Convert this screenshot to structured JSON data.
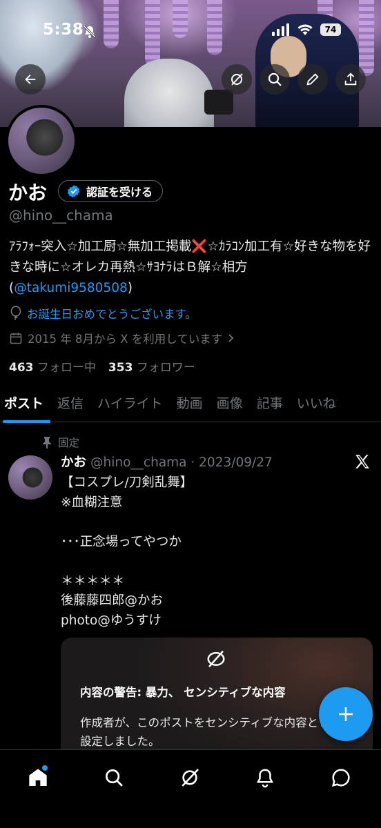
{
  "status_bar": {
    "time": "5:38",
    "battery": "74"
  },
  "profile": {
    "name": "かお",
    "verify_label": "認証を受ける",
    "handle": "@hino__chama",
    "bio_text": "ｱﾗﾌｫｰ突入☆加工厨☆無加工掲載❌☆ｶﾗｺﾝ加工有☆好きな物を好きな時に☆オレカ再熱☆ｻﾖﾅﾗはＢ解☆相方",
    "bio_mention_open": "(",
    "bio_mention": "@takumi9580508",
    "bio_mention_close": ")",
    "birthday": "お誕生日おめでとうございます。",
    "joined": "2015 年 8月から X を利用しています",
    "following_count": "463",
    "following_label": "フォロー中",
    "followers_count": "353",
    "followers_label": "フォロワー"
  },
  "tabs": [
    "ポスト",
    "返信",
    "ハイライト",
    "動画",
    "画像",
    "記事",
    "いいね"
  ],
  "post": {
    "pinned_label": "固定",
    "author": "かお",
    "handle_date": "@hino__chama · 2023/09/27",
    "text": "【コスプレ/刀剣乱舞】\n※血糊注意\n\n･･･正念場ってやつか\n\n＊＊＊＊＊\n後藤藤四郎@かお\nphoto@ゆうすけ",
    "warning_title": "内容の警告: 暴力、 センシティブな内容",
    "warning_body": "作成者が、このポストをセンシティブな内容として設定しました。"
  },
  "colors": {
    "accent": "#1d9bf0",
    "background": "#000000",
    "muted": "#71767b"
  },
  "icons": [
    "back-arrow-icon",
    "grok-icon",
    "search-icon",
    "edit-icon",
    "share-icon",
    "verified-badge-icon",
    "balloon-icon",
    "calendar-icon",
    "pin-icon",
    "x-logo-icon",
    "hidden-icon",
    "plus-icon",
    "home-icon",
    "explore-icon",
    "grok-icon",
    "bell-icon",
    "messages-icon"
  ]
}
